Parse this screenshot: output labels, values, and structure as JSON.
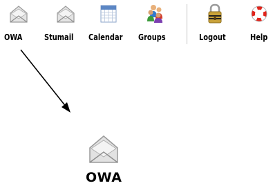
{
  "toolbar": {
    "items": [
      {
        "label": "OWA",
        "icon": "envelope-icon"
      },
      {
        "label": "Stumail",
        "icon": "envelope-icon"
      },
      {
        "label": "Calendar",
        "icon": "calendar-icon"
      },
      {
        "label": "Groups",
        "icon": "people-icon"
      },
      {
        "label": "Logout",
        "icon": "padlock-icon"
      },
      {
        "label": "Help",
        "icon": "lifebuoy-icon"
      }
    ]
  },
  "zoom": {
    "label": "OWA",
    "icon": "envelope-icon"
  },
  "colors": {
    "envelope_fill": "#e2e2e2",
    "envelope_stroke": "#9a9a9a",
    "calendar_header": "#5b86c4",
    "lifebuoy_red": "#e0241b",
    "separator": "#c4c4c4",
    "arrow": "#000000"
  }
}
